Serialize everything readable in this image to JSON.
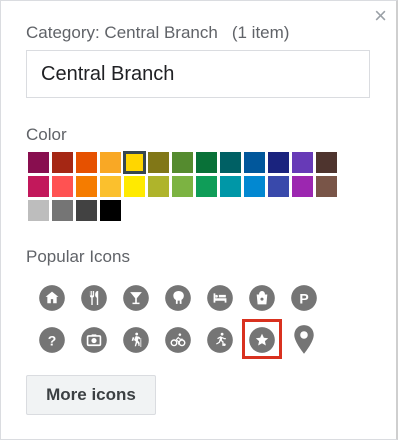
{
  "dialog": {
    "header": "Category: Central Branch",
    "count": "(1 item)",
    "close_symbol": "×",
    "name_value": "Central Branch"
  },
  "color_section": {
    "label": "Color",
    "selected_index": 4,
    "palette": [
      "#880e4f",
      "#a52714",
      "#e65100",
      "#f9a825",
      "#ffd600",
      "#817717",
      "#558b2f",
      "#097138",
      "#006064",
      "#01579b",
      "#1a237e",
      "#673ab7",
      "#4e342e",
      "#c2185b",
      "#ff5252",
      "#f57c00",
      "#fbc02d",
      "#ffea00",
      "#afb42b",
      "#7cb342",
      "#0f9d58",
      "#0097a7",
      "#0288d1",
      "#3949ab",
      "#9c27b0",
      "#795548",
      "#bdbdbd",
      "#757575",
      "#424242",
      "#000000"
    ]
  },
  "icon_section": {
    "label": "Popular Icons",
    "icon_color": "#757575",
    "selected_index": 12,
    "icons": [
      "home-icon",
      "restaurant-icon",
      "bar-icon",
      "animal-icon",
      "lodging-icon",
      "shopping-icon",
      "parking-icon",
      "help-icon",
      "camera-icon",
      "hiking-icon",
      "cycling-icon",
      "soccer-icon",
      "star-icon",
      "map-pin-icon"
    ]
  },
  "more_icons_label": "More icons"
}
